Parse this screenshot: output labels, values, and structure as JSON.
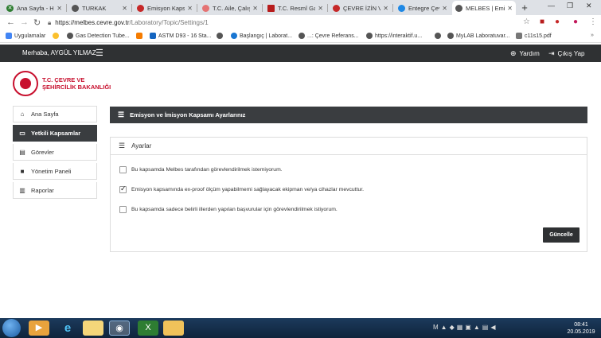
{
  "browser": {
    "tabs": [
      {
        "title": "Ana Sayfa - Ha",
        "color": "#2e7d32"
      },
      {
        "title": "TURKAK",
        "color": "#555555"
      },
      {
        "title": "Emisyon Kapsa",
        "color": "#c62828"
      },
      {
        "title": "T.C. Aile, Çalışı",
        "color": "#e57373"
      },
      {
        "title": "T.C. Resmî Gaze",
        "color": "#b71c1c"
      },
      {
        "title": "ÇEVRE İZİN VE",
        "color": "#c62828"
      },
      {
        "title": "Entegre Çevre",
        "color": "#1e88e5"
      },
      {
        "title": "MELBES | Emis",
        "color": "#555555"
      }
    ],
    "url_host": "https://melbes.cevre.gov.tr",
    "url_path": "/Laboratory/Topic/Settings/1",
    "bookmarks": [
      {
        "label": "Uygulamalar",
        "color": "#4285f4"
      },
      {
        "label": "Gas Detection Tube...",
        "color": "#555555"
      },
      {
        "label": "",
        "color": "#f57c00"
      },
      {
        "label": "ASTM D93 - 16 Sta...",
        "color": "#1565c0"
      },
      {
        "label": "Başlangıç | Laborat...",
        "color": "#1976d2"
      },
      {
        "label": "...: Çevre Referans...",
        "color": "#555555"
      },
      {
        "label": "https://interaktif.u...",
        "color": "#555555"
      },
      {
        "label": "MyLAB Laboratuvar...",
        "color": "#555555"
      },
      {
        "label": "c11s15.pdf",
        "color": "#777777"
      }
    ]
  },
  "header": {
    "greeting": "Merhaba, AYGÜL YILMAZ",
    "help": "Yardım",
    "logout": "Çıkış Yap"
  },
  "logo": {
    "line1": "T.C. ÇEVRE VE",
    "line2": "ŞEHİRCİLİK BAKANLIĞI"
  },
  "sidebar": {
    "items": [
      {
        "label": "Ana Sayfa",
        "icon": "home-icon",
        "glyph": "⌂"
      },
      {
        "label": "Yetkili Kapsamlar",
        "icon": "folder-icon",
        "glyph": "▭"
      },
      {
        "label": "Görevler",
        "icon": "document-icon",
        "glyph": "▤"
      },
      {
        "label": "Yönetim Paneli",
        "icon": "lock-icon",
        "glyph": "■"
      },
      {
        "label": "Raporlar",
        "icon": "chart-icon",
        "glyph": "▥"
      }
    ]
  },
  "main": {
    "title": "Emisyon ve İmisyon Kapsamı Ayarlarınız",
    "card_title": "Ayarlar",
    "options": [
      {
        "label": "Bu kapsamda Melbes tarafından görevlendirilmek istemiyorum.",
        "checked": false
      },
      {
        "label": "Emisyon kapsamında ex-proof ölçüm yapabilmemi sağlayacak ekipman ve/ya cihazlar mevcuttur.",
        "checked": true
      },
      {
        "label": "Bu kapsamda sadece belirli illerden yapılan başvurular için görevlendirilmek istiyorum.",
        "checked": false
      }
    ],
    "submit": "Güncelle"
  },
  "taskbar": {
    "time": "08:41",
    "date": "20.05.2019"
  },
  "colors": {
    "dark": "#2f3133",
    "brand_red": "#c8102e"
  }
}
